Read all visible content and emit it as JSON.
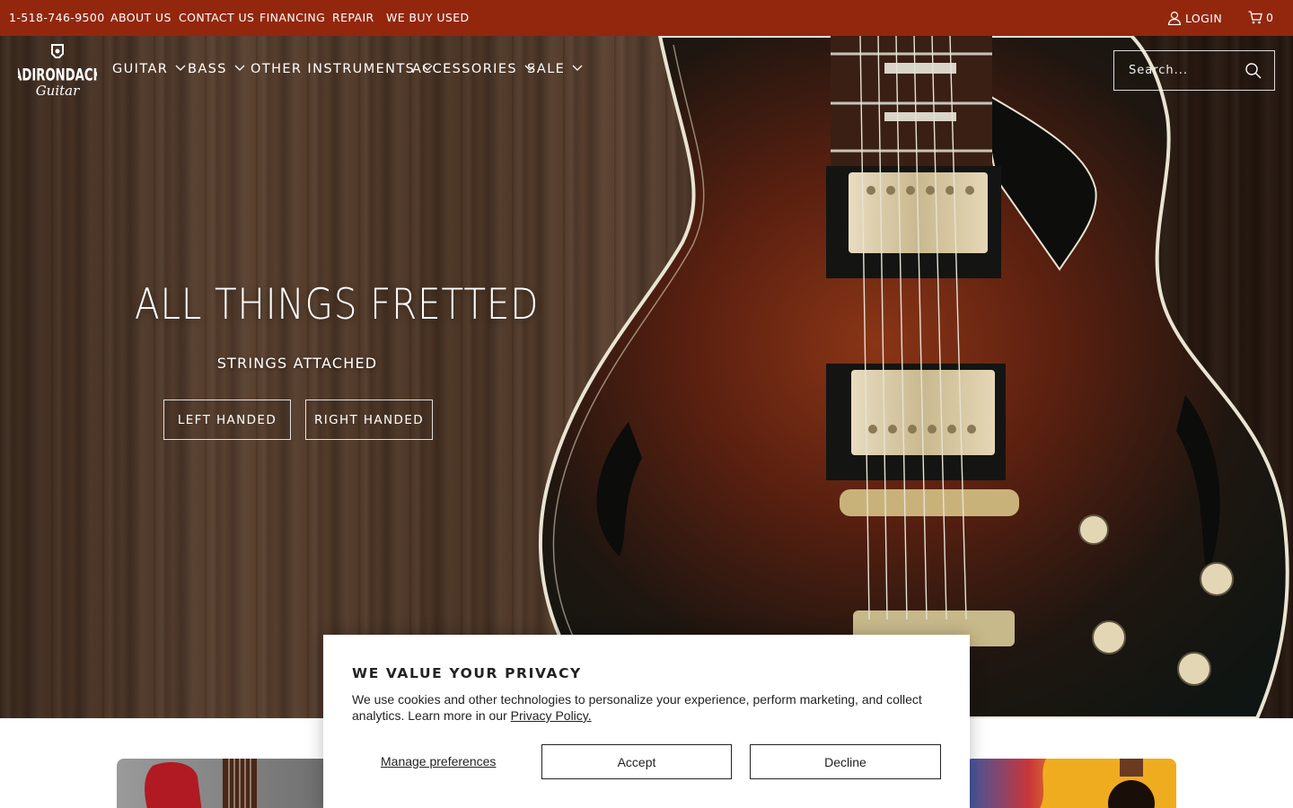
{
  "topbar": {
    "phone": "1-518-746-9500",
    "links": [
      "ABOUT US",
      "CONTACT US",
      "FINANCING",
      "REPAIR",
      "WE BUY USED"
    ],
    "login": "LOGIN",
    "cart_count": "0",
    "background": "#93270e"
  },
  "brand": {
    "name_line1": "ADIRONDACK",
    "name_line2": "Guitar"
  },
  "nav": {
    "items": [
      {
        "label": "GUITAR",
        "has_dropdown": true
      },
      {
        "label": "BASS",
        "has_dropdown": true
      },
      {
        "label": "OTHER INSTRUMENTS",
        "has_dropdown": true
      },
      {
        "label": "ACCESSORIES",
        "has_dropdown": true
      },
      {
        "label": "SALE",
        "has_dropdown": true
      }
    ]
  },
  "search": {
    "placeholder": "Search...",
    "icon": "search-icon"
  },
  "hero": {
    "title": "ALL THINGS FRETTED",
    "subtitle": "STRINGS ATTACHED",
    "buttons": [
      "LEFT HANDED",
      "RIGHT HANDED"
    ]
  },
  "cookie": {
    "title": "WE VALUE YOUR PRIVACY",
    "body": "We use cookies and other technologies to personalize your experience, perform marketing, and collect analytics. Learn more in our",
    "policy_link": "Privacy Policy.",
    "manage": "Manage preferences",
    "accept": "Accept",
    "decline": "Decline"
  }
}
